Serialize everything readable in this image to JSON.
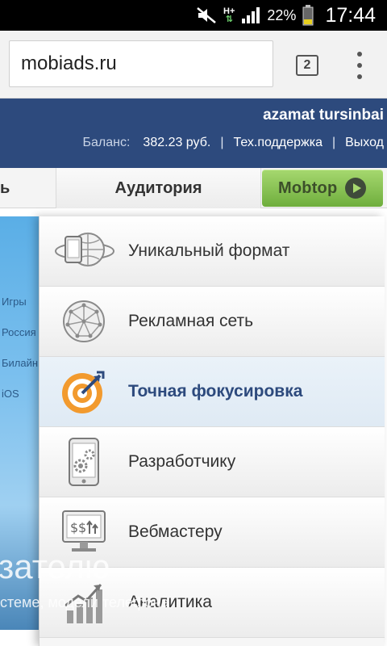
{
  "status_bar": {
    "network": "H+",
    "battery_percent": "22%",
    "time": "17:44"
  },
  "browser": {
    "url": "mobiads.ru",
    "tab_count": "2"
  },
  "header": {
    "username": "azamat tursinbai",
    "balance_label": "Баланс:",
    "balance_value": "382.23 руб.",
    "separator": "|",
    "support_link": "Тех.поддержка",
    "logout_link": "Выход"
  },
  "nav": {
    "left_tab_fragment": "ь",
    "audience_tab": "Аудитория",
    "mobtop_button": "Mobtop"
  },
  "background": {
    "side_items": [
      "Игры",
      "Россия",
      "Билайн",
      "iOS"
    ],
    "big_text": "зателю",
    "sub_text": "стеме, модели телефона"
  },
  "menu": {
    "items": [
      {
        "label": "Уникальный формат",
        "icon": "globe-phone-icon",
        "active": false
      },
      {
        "label": "Рекламная сеть",
        "icon": "network-globe-icon",
        "active": false
      },
      {
        "label": "Точная фокусировка",
        "icon": "target-icon",
        "active": true
      },
      {
        "label": "Разработчику",
        "icon": "phone-gears-icon",
        "active": false
      },
      {
        "label": "Вебмастеру",
        "icon": "monitor-money-icon",
        "active": false
      },
      {
        "label": "Аналитика",
        "icon": "growth-chart-icon",
        "active": false
      }
    ]
  },
  "colors": {
    "header_bg": "#2d4a7d",
    "mobtop_green": "#8cc657",
    "target_orange": "#f29a2e",
    "active_text": "#2d4a7d"
  }
}
